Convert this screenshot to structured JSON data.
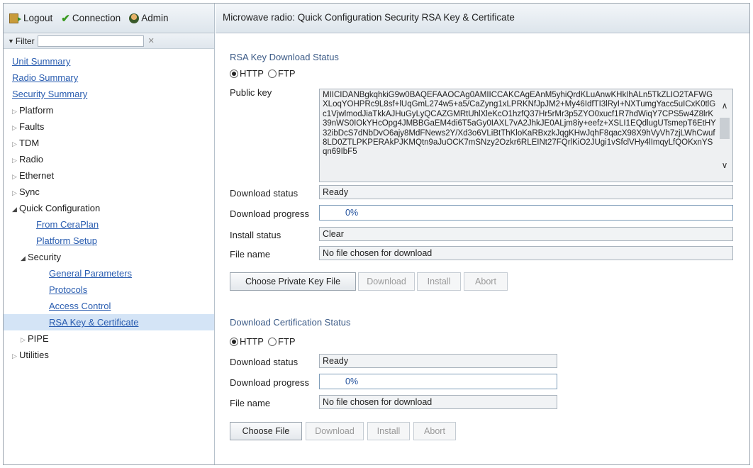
{
  "topbar": {
    "logout": "Logout",
    "connection": "Connection",
    "admin": "Admin"
  },
  "filter": {
    "label": "Filter",
    "value": ""
  },
  "tree": {
    "unit_summary": "Unit Summary",
    "radio_summary": "Radio Summary",
    "security_summary": "Security Summary",
    "platform": "Platform",
    "faults": "Faults",
    "tdm": "TDM",
    "radio": "Radio",
    "ethernet": "Ethernet",
    "sync": "Sync",
    "quick_configuration": "Quick Configuration",
    "from_ceraplan": "From CeraPlan",
    "platform_setup": "Platform Setup",
    "security": "Security",
    "general_parameters": "General Parameters",
    "protocols": "Protocols",
    "access_control": "Access Control",
    "rsa_key_certificate": "RSA Key & Certificate",
    "pipe": "PIPE",
    "utilities": "Utilities"
  },
  "header": {
    "title": "Microwave radio: Quick Configuration Security RSA Key & Certificate"
  },
  "rsa": {
    "section_title": "RSA Key Download Status",
    "protocol_http": "HTTP",
    "protocol_ftp": "FTP",
    "selected_protocol": "HTTP",
    "public_key_label": "Public key",
    "public_key_value": "MIICIDANBgkqhkiG9w0BAQEFAAOCAg0AMIICCAKCAgEAnM5yhiQrdKLuAnwKHkIhALn5TkZLIO2TAFWGXLoqYOHPRc9L8sf+lUqGmL274w5+a5/CaZyng1xLPRKNfJpJM2+My46IdfTI3lRyI+NXTumgYacc5uICxK0tlGc1VjwlmodJiaTkkAJHuGyLyQCAZGMRtUhlXleKcO1hzfQ37Hr5rMr3p5ZYO0xucf1R7hdWiqY7CPS5w4Z8lrK39nWS0IOkYHcOpg4JMBBGaEM4di6T5aGy0IAXL7vA2JhkJE0ALjm8iy+eefz+XSLI1EQdlugUTsmepT6EtHY32ibDcS7dNbDvO6ajy8MdFNews2Y/Xd3o6VLiBtThKloKaRBxzkJqgKHwJqhF8qacX98X9hVyVh7zjLWhCwuf8LD0ZTLPKPERAkPJKMQtn9aJuOCK7mSNzy2Ozkr6RLEINt27FQrlKiO2JUgi1vSfclVHy4lImqyLfQOKxnYSqn69IbF5",
    "download_status_label": "Download status",
    "download_status_value": "Ready",
    "download_progress_label": "Download progress",
    "download_progress_value": "0%",
    "install_status_label": "Install status",
    "install_status_value": "Clear",
    "file_name_label": "File name",
    "file_name_value": "No file chosen for download",
    "choose_button": "Choose Private Key File",
    "download_button": "Download",
    "install_button": "Install",
    "abort_button": "Abort"
  },
  "cert": {
    "section_title": "Download Certification Status",
    "protocol_http": "HTTP",
    "protocol_ftp": "FTP",
    "selected_protocol": "HTTP",
    "download_status_label": "Download status",
    "download_status_value": "Ready",
    "download_progress_label": "Download progress",
    "download_progress_value": "0%",
    "file_name_label": "File name",
    "file_name_value": "No file chosen for download",
    "choose_button": "Choose File",
    "download_button": "Download",
    "install_button": "Install",
    "abort_button": "Abort"
  }
}
